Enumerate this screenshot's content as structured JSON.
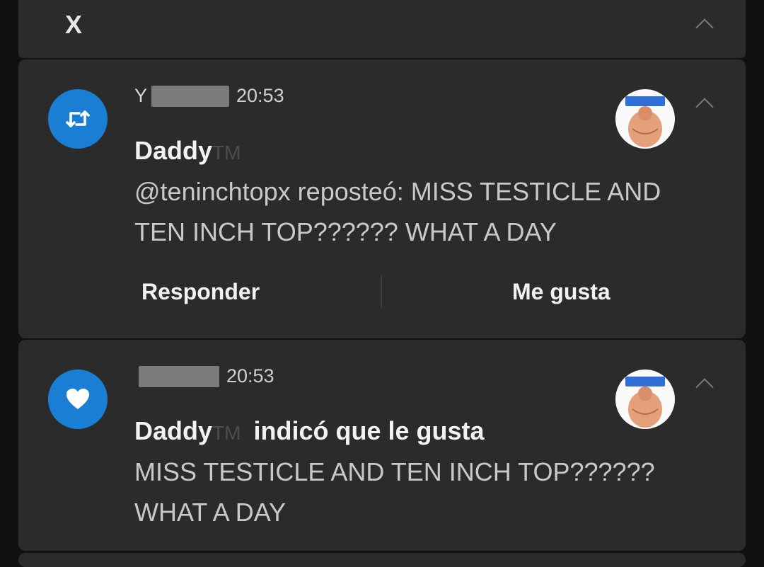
{
  "group": {
    "app_glyph": "X"
  },
  "notifications": [
    {
      "type_icon": "retweet-icon",
      "sender_initial": "Y",
      "time": "20:53",
      "title": "Daddy",
      "title_suffix": "TM",
      "title_action": "",
      "body": "@teninchtopx reposteó: MISS TESTICLE AND TEN INCH TOP?????? WHAT A DAY",
      "actions": [
        "Responder",
        "Me gusta"
      ]
    },
    {
      "type_icon": "heart-icon",
      "sender_initial": "",
      "time": "20:53",
      "title": "Daddy",
      "title_suffix": "TM",
      "title_action": "indicó que le gusta",
      "body": "MISS TESTICLE AND TEN INCH TOP?????? WHAT A DAY"
    }
  ],
  "colors": {
    "accent": "#1a7fd4",
    "card": "#2b2b2b",
    "background": "#111111"
  }
}
